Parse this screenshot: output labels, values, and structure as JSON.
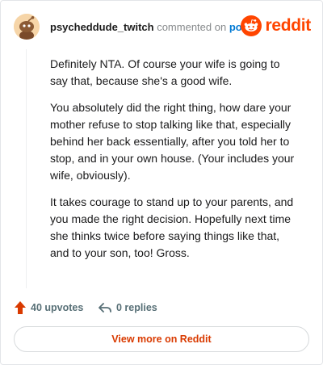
{
  "header": {
    "username": "psycheddude_twitch",
    "commented_on": "commented on",
    "post_link": "post",
    "brand": "reddit"
  },
  "comment": {
    "paragraphs": [
      "Definitely NTA. Of course your wife is going to say that, because she's a good wife.",
      "You absolutely did the right thing, how dare your mother refuse to stop talking like that, especially behind her back essentially, after you told her to stop, and in your own house. (Your includes your wife, obviously).",
      "It takes courage to stand up to your parents, and you made the right decision. Hopefully next time she thinks twice before saying things like that, and to your son, too! Gross."
    ]
  },
  "actions": {
    "upvotes": "40 upvotes",
    "replies": "0 replies"
  },
  "footer": {
    "view_more": "View more on Reddit"
  },
  "colors": {
    "reddit_orange": "#ff4500",
    "upvote": "#d93a00",
    "link_blue": "#0079d3"
  },
  "icons": {
    "avatar": "snoo-avatar-icon",
    "logo": "reddit-snoo-icon",
    "upvote": "upvote-arrow-icon",
    "reply": "reply-arrow-icon"
  }
}
